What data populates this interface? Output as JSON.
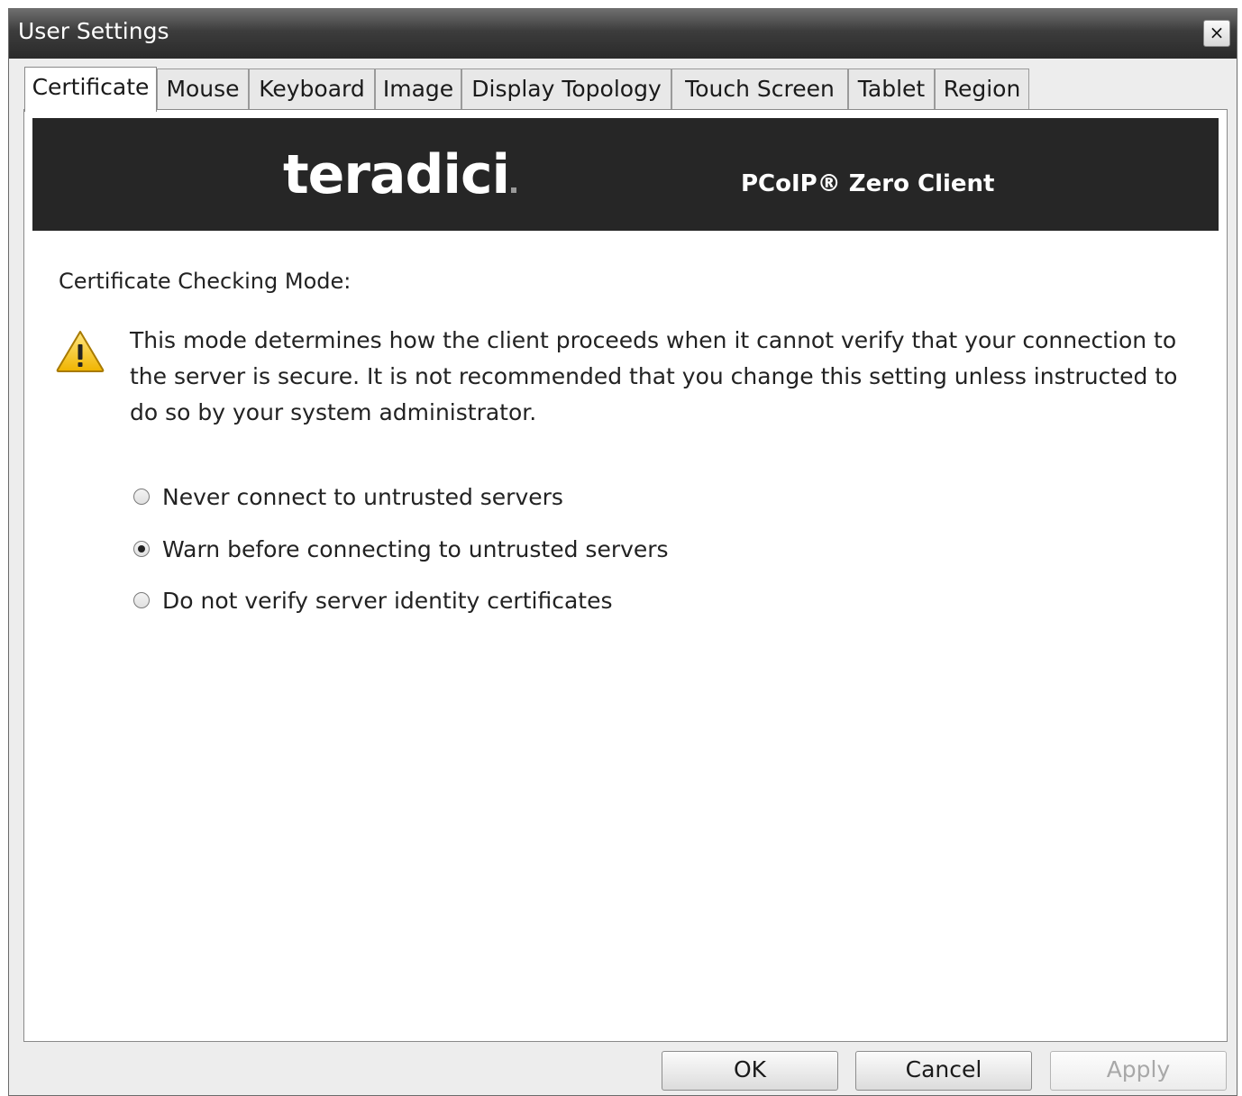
{
  "window": {
    "title": "User Settings",
    "close_symbol": "×"
  },
  "tabs": [
    {
      "label": "Certificate",
      "active": true
    },
    {
      "label": "Mouse",
      "active": false
    },
    {
      "label": "Keyboard",
      "active": false
    },
    {
      "label": "Image",
      "active": false
    },
    {
      "label": "Display Topology",
      "active": false
    },
    {
      "label": "Touch Screen",
      "active": false
    },
    {
      "label": "Tablet",
      "active": false
    },
    {
      "label": "Region",
      "active": false
    }
  ],
  "banner": {
    "logo": "teradici",
    "product": "PCoIP® Zero Client"
  },
  "certificate": {
    "section_label": "Certificate Checking Mode:",
    "warning_text": "This mode determines how the client proceeds when it cannot verify that your connection to the server is secure. It is not recommended that you change this setting unless instructed to do so by your system administrator.",
    "warning_icon": "warning-triangle-icon",
    "options": [
      {
        "label": "Never connect to untrusted servers",
        "selected": false
      },
      {
        "label": "Warn before connecting to untrusted servers",
        "selected": true
      },
      {
        "label": "Do not verify server identity certificates",
        "selected": false
      }
    ]
  },
  "buttons": {
    "ok": "OK",
    "cancel": "Cancel",
    "apply": "Apply",
    "apply_enabled": false
  }
}
